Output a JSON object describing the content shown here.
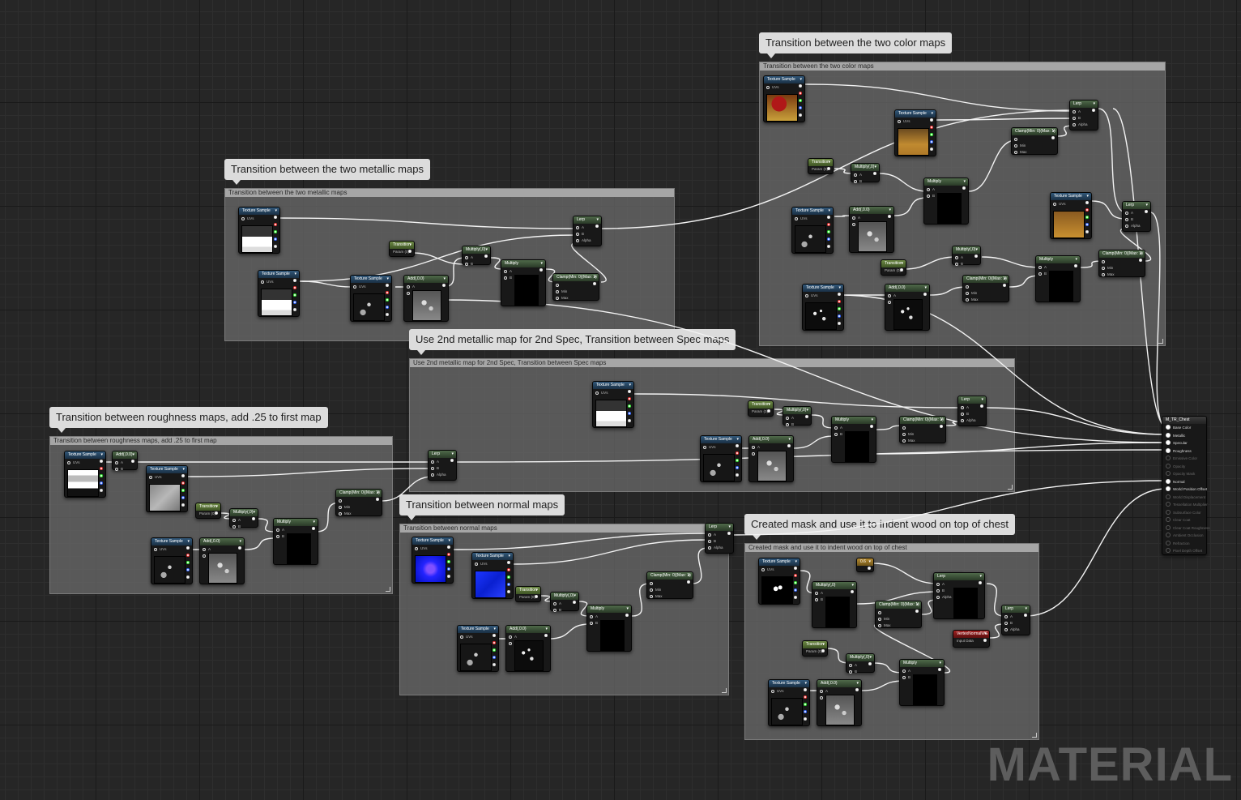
{
  "comments": {
    "color": "Transition between the two color maps",
    "metallic": "Transition between the two metallic maps",
    "spec": "Use 2nd metallic map for 2nd Spec, Transition between Spec maps",
    "roughness": "Transition between roughness maps, add .25 to first map",
    "normal": "Transition between normal maps",
    "mask": "Created mask and use it to indent wood on top of chest"
  },
  "node_titles": {
    "texture_sample": "Texture Sample",
    "lerp": "Lerp",
    "multiply": "Multiply",
    "multiply_param": "Multiply(,0)",
    "add": "Add(,0.0)",
    "clamp": "Clamp(Min: 0)(Max: 1)",
    "transition": "Transition",
    "gold_param": "0.6",
    "vertex_normal": "VertexNormalWS",
    "result": "M_TR_Chest"
  },
  "pins": {
    "uvs": "UVs",
    "a": "A",
    "b": "B",
    "alpha": "Alpha",
    "min": "Min",
    "max": "Max",
    "param_value": "Param (0)",
    "vertex_sub": "Input Data"
  },
  "result_pins": [
    {
      "label": "Base Color",
      "active": true
    },
    {
      "label": "Metallic",
      "active": true
    },
    {
      "label": "Specular",
      "active": true
    },
    {
      "label": "Roughness",
      "active": true
    },
    {
      "label": "Emissive Color",
      "active": false
    },
    {
      "label": "Opacity",
      "active": false
    },
    {
      "label": "Opacity Mask",
      "active": false
    },
    {
      "label": "Normal",
      "active": true
    },
    {
      "label": "World Position Offset",
      "active": true
    },
    {
      "label": "World Displacement",
      "active": false
    },
    {
      "label": "Tessellation Multiplier",
      "active": false
    },
    {
      "label": "Subsurface Color",
      "active": false
    },
    {
      "label": "Clear Coat",
      "active": false
    },
    {
      "label": "Clear Coat Roughness",
      "active": false
    },
    {
      "label": "Ambient Occlusion",
      "active": false
    },
    {
      "label": "Refraction",
      "active": false
    },
    {
      "label": "Pixel Depth Offset",
      "active": false
    }
  ],
  "brand": "MATERIAL",
  "colors": {
    "background": "#262626",
    "group_fill": "#686868",
    "texture_header": "#31587a",
    "param_header": "#6e8a45",
    "wire": "#ffffff"
  }
}
